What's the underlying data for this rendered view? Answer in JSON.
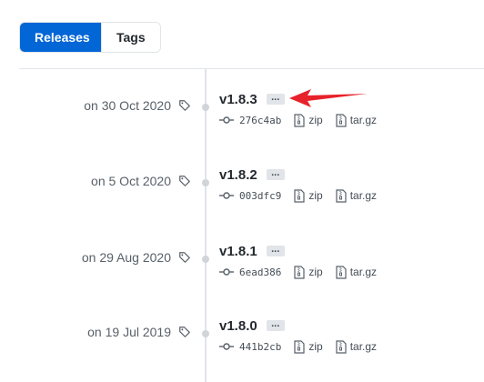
{
  "tabs": [
    {
      "label": "Releases",
      "active": true
    },
    {
      "label": "Tags",
      "active": false
    }
  ],
  "releases": [
    {
      "date": "on 30 Oct 2020",
      "version": "v1.8.3",
      "more": "...",
      "commit": "276c4ab",
      "zip": "zip",
      "tar": "tar.gz"
    },
    {
      "date": "on 5 Oct 2020",
      "version": "v1.8.2",
      "more": "...",
      "commit": "003dfc9",
      "zip": "zip",
      "tar": "tar.gz"
    },
    {
      "date": "on 29 Aug 2020",
      "version": "v1.8.1",
      "more": "...",
      "commit": "6ead386",
      "zip": "zip",
      "tar": "tar.gz"
    },
    {
      "date": "on 19 Jul 2019",
      "version": "v1.8.0",
      "more": "...",
      "commit": "441b2cb",
      "zip": "zip",
      "tar": "tar.gz"
    }
  ],
  "colors": {
    "accent": "#0366d6",
    "annotation_arrow": "#e8222a"
  },
  "icons": {
    "tag": "tag-icon",
    "commit": "git-commit-icon",
    "archive": "file-zip-icon"
  }
}
